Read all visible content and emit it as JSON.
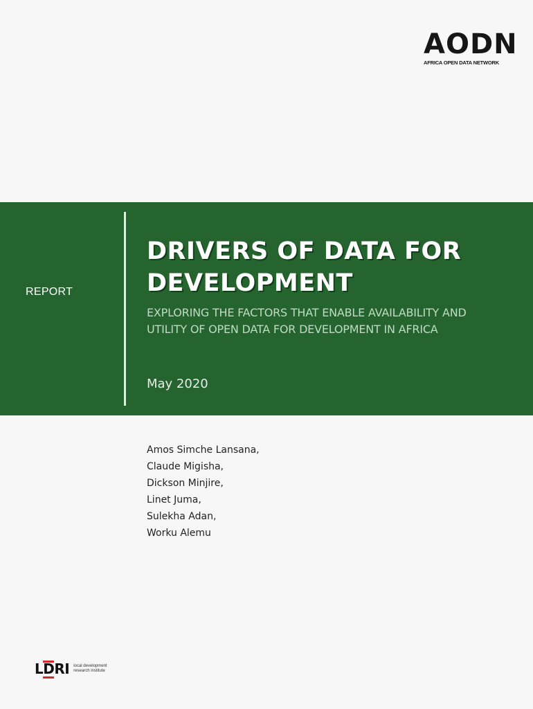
{
  "header": {
    "logo_wordmark": "AODN",
    "logo_tagline": "AFRICA OPEN DATA NETWORK"
  },
  "cover": {
    "label": "REPORT",
    "title": "DRIVERS OF DATA FOR DEVELOPMENT",
    "subtitle": "EXPLORING THE FACTORS THAT ENABLE AVAILABILITY AND UTILITY OF OPEN DATA FOR DEVELOPMENT IN AFRICA",
    "date": "May 2020"
  },
  "authors": [
    "Amos Simche Lansana,",
    "Claude Migisha,",
    "Dickson Minjire,",
    "Linet Juma,",
    "Sulekha Adan,",
    "Worku Alemu"
  ],
  "footer": {
    "logo_mark_l": "L",
    "logo_mark_d": "D",
    "logo_mark_ri": "RI",
    "logo_text": "local development research institute"
  },
  "colors": {
    "band": "#25642f",
    "background": "#f7f7f7",
    "accent_red": "#d22a2a"
  }
}
